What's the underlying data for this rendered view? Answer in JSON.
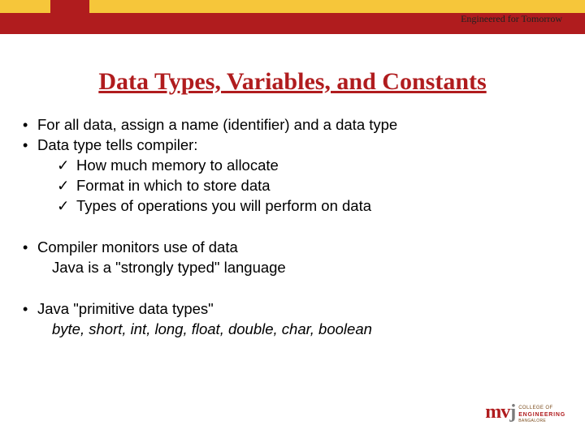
{
  "header": {
    "tagline": "Engineered for Tomorrow"
  },
  "title": "Data Types, Variables, and Constants",
  "bullets": {
    "b1": "For all data, assign a name (identifier) and a data type",
    "b2": "Data type tells compiler:",
    "s1": "How much memory to allocate",
    "s2": "Format in which to store data",
    "s3": "Types of operations you will perform on data",
    "b3": "Compiler monitors use of data",
    "b3_sub": "Java is a \"strongly typed\" language",
    "b4": "Java \"primitive data types\"",
    "b4_sub": "byte, short, int, long, float, double, char, boolean"
  },
  "logo": {
    "mark": "mvj",
    "line1": "COLLEGE OF",
    "line2": "ENGINEERING",
    "line3": "BANGALORE"
  }
}
